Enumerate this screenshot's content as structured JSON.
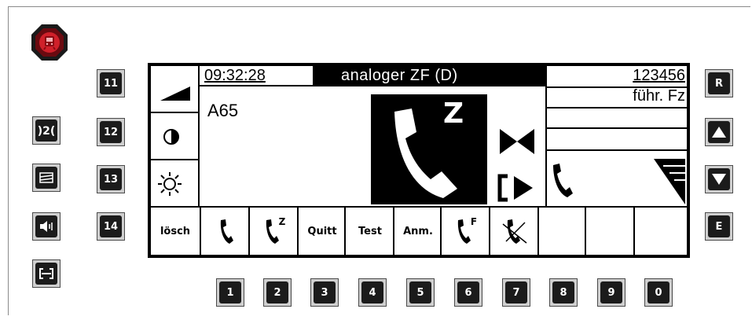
{
  "status_bar": {
    "time": "09:32:28",
    "mode": "analoger ZF (D)",
    "number": "123456",
    "role": "führ. Fz"
  },
  "train": {
    "id": "A65"
  },
  "call_icon_letter": "Z",
  "softkeys": [
    {
      "label": "lösch"
    },
    {
      "label": ""
    },
    {
      "label": ""
    },
    {
      "label": "Quitt"
    },
    {
      "label": "Test"
    },
    {
      "label": "Anm."
    },
    {
      "label": ""
    },
    {
      "label": ""
    }
  ],
  "softkey_sups": {
    "k2": "Z",
    "k6": "F"
  },
  "left_keys": [
    "11",
    "12",
    "13",
    "14"
  ],
  "right_keys": {
    "r": "R",
    "e": "E"
  },
  "number_keys": [
    "1",
    "2",
    "3",
    "4",
    "5",
    "6",
    "7",
    "8",
    "9",
    "0"
  ],
  "side_icons": [
    "bypass-icon",
    "window-icon",
    "speaker-icon",
    "coupling-icon"
  ],
  "colors": {
    "stop": "#d0202a",
    "screen_border": "#000000",
    "key": "#1b1b1b"
  }
}
